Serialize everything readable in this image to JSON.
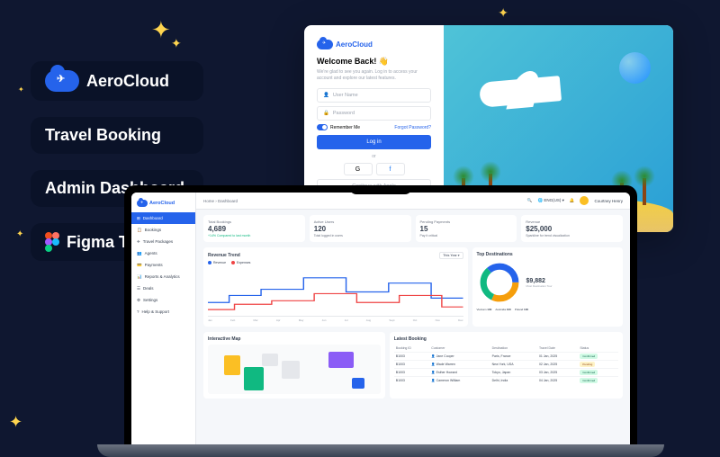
{
  "brand": "AeroCloud",
  "badges": {
    "travel": "Travel Booking",
    "admin": "Admin Dashboard",
    "figma": "Figma Template"
  },
  "login": {
    "heading": "Welcome Back! 👋",
    "sub": "We're glad to see you again. Log in to access your account and explore our latest features.",
    "username": "User Name",
    "password": "Password",
    "remember": "Remember Me",
    "forgot": "Forgot Password?",
    "button": "Log in",
    "or": "or",
    "apple": "Continue with Apple"
  },
  "sidebar": {
    "items": [
      {
        "icon": "⊞",
        "label": "Dashboard",
        "active": true
      },
      {
        "icon": "📋",
        "label": "Bookings"
      },
      {
        "icon": "✈",
        "label": "Travel Packages"
      },
      {
        "icon": "👥",
        "label": "Agents"
      },
      {
        "icon": "💳",
        "label": "Payments"
      },
      {
        "icon": "📊",
        "label": "Reports & Analytics"
      },
      {
        "icon": "☰",
        "label": "Deals"
      },
      {
        "icon": "⚙",
        "label": "Settings"
      },
      {
        "icon": "?",
        "label": "Help & Support"
      }
    ]
  },
  "breadcrumb": "Home  ›  Dashboard",
  "topbar": {
    "lang": "ENG(US)",
    "user": "Courtney Henry"
  },
  "stats": [
    {
      "label": "Total Bookings",
      "value": "4,689",
      "sub": "+14% Compared to last month",
      "green": true
    },
    {
      "label": "Active Users",
      "value": "120",
      "sub": "Total logged in users"
    },
    {
      "label": "Pending Payments",
      "value": "15",
      "sub": "Pay it critical"
    },
    {
      "label": "Revenue",
      "value": "$25,000",
      "sub": "Sparkline for trend visualization"
    }
  ],
  "chart_data": {
    "type": "line",
    "title": "Revenue Trend",
    "filter": "This Year",
    "series": [
      {
        "name": "Revenue",
        "color": "#2563eb"
      },
      {
        "name": "Expenses",
        "color": "#ef4444"
      }
    ],
    "categories": [
      "Jan",
      "Feb",
      "Mar",
      "Apr",
      "May",
      "Jun",
      "Jul",
      "Aug",
      "Sept",
      "Oct",
      "Nov",
      "Dec"
    ],
    "donut_value": "$9,882",
    "donut_sub": "Most Destination Tour"
  },
  "dest_title": "Top Destinations",
  "dest_legend": [
    {
      "label": "Vietnam",
      "value": "100",
      "color": "#2563eb"
    },
    {
      "label": "Australia",
      "value": "100",
      "color": "#10b981"
    },
    {
      "label": "Poland",
      "value": "100",
      "color": "#f59e0b"
    }
  ],
  "map_title": "Interactive Map",
  "table": {
    "title": "Latest Booking",
    "headers": [
      "Booking ID",
      "Customer",
      "Destination",
      "Travel Date",
      "Status"
    ],
    "rows": [
      {
        "id": "B1003",
        "customer": "Jane Cooper",
        "dest": "Paris, France",
        "date": "01 Jan, 2025",
        "status": "Confirmed",
        "st": "c"
      },
      {
        "id": "B1003",
        "customer": "Wade Warren",
        "dest": "New York, USA",
        "date": "02 Jan, 2025",
        "status": "Pending",
        "st": "p"
      },
      {
        "id": "B1003",
        "customer": "Esther Howard",
        "dest": "Tokyo, Japan",
        "date": "03 Jan, 2025",
        "status": "Confirmed",
        "st": "c"
      },
      {
        "id": "B1003",
        "customer": "Cameron William",
        "dest": "Delhi, India",
        "date": "04 Jan, 2025",
        "status": "Confirmed",
        "st": "c"
      }
    ]
  }
}
